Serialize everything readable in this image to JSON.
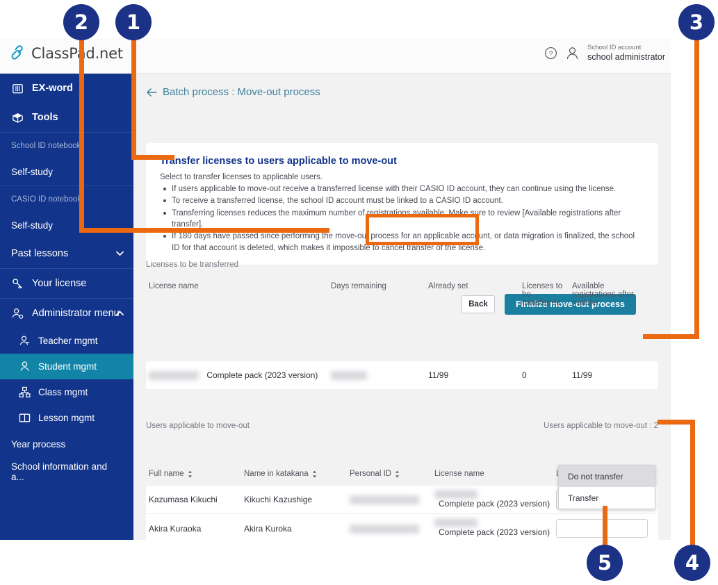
{
  "app": {
    "logo_text": "ClassPad.net",
    "logo_icon": "chain-link-icon"
  },
  "topbar": {
    "help_icon": "question-mark-circle-icon",
    "user_icon": "person-icon",
    "account_kind": "School ID account",
    "account_name": "school administrator"
  },
  "sidebar": {
    "items": [
      {
        "label": "EX-word",
        "icon": "book-icon",
        "type": "main"
      },
      {
        "label": "Tools",
        "icon": "box-icon",
        "type": "main"
      },
      {
        "label": "School ID notebook",
        "type": "caption"
      },
      {
        "label": "Self-study",
        "type": "plain"
      },
      {
        "label": "CASIO ID notebook",
        "type": "caption"
      },
      {
        "label": "Self-study",
        "type": "plain"
      },
      {
        "label": "Past lessons",
        "type": "plain",
        "chevron": "chevron-down-icon"
      },
      {
        "label": "Your license",
        "icon": "key-icon",
        "type": "main"
      },
      {
        "label": "Administrator menu",
        "icon": "person-gear-icon",
        "type": "main",
        "chevron": "chevron-up-icon"
      },
      {
        "label": "Teacher mgmt",
        "icon": "person-icon",
        "type": "sub"
      },
      {
        "label": "Student mgmt",
        "icon": "person-icon",
        "type": "sub",
        "active": true
      },
      {
        "label": "Class mgmt",
        "icon": "org-chart-icon",
        "type": "sub"
      },
      {
        "label": "Lesson mgmt",
        "icon": "open-book-icon",
        "type": "sub"
      },
      {
        "label": "Year process",
        "type": "plain"
      },
      {
        "label": "School information and a...",
        "type": "plain"
      }
    ]
  },
  "breadcrumb": {
    "back_icon": "left-arrow-icon",
    "label": "Batch process : Move-out process"
  },
  "info_card": {
    "title": "Transfer licenses to users applicable to move-out",
    "lead": "Select to transfer licenses to applicable users.",
    "bullets": [
      "If users applicable to move-out receive a transferred license with their CASIO ID account, they can continue using the license.",
      "To receive a transferred license, the school ID account must be linked to a CASIO ID account.",
      "Transferring licenses reduces the maximum number of registrations available. Make sure to review [Available registrations after transfer].",
      "If 180 days have passed since performing the move-out process for an applicable account, or data migration is finalized, the school ID for that account is deleted, which makes it impossible to cancel transfer of the license."
    ]
  },
  "buttons": {
    "back": "Back",
    "finalize": "Finalize move-out process"
  },
  "licenses_section": {
    "caption": "Licenses to be transferred",
    "columns": [
      "License name",
      "Days remaining",
      "Already set",
      "Licenses to be transferred",
      "Available registrations after transfer"
    ],
    "rows": [
      {
        "license_name": "Complete pack (2023 version)",
        "days_remaining": "",
        "already_set": "11/99",
        "to_be_transferred": "0",
        "available_after": "11/99"
      }
    ]
  },
  "users_section": {
    "caption": "Users applicable to move-out",
    "count_label": "Users applicable to move-out : 2",
    "columns": [
      "Full name",
      "Name in katakana",
      "Personal ID",
      "License name",
      "License transfer"
    ],
    "rows": [
      {
        "full_name": "Kazumasa Kikuchi",
        "katakana": "Kikuchi Kazushige",
        "personal_id": "",
        "license_name": "Complete pack (2023 version)",
        "license_transfer": ""
      },
      {
        "full_name": "Akira Kuraoka",
        "katakana": "Akira Kuroka",
        "personal_id": "",
        "license_name": "Complete pack (2023 version)",
        "license_transfer": ""
      }
    ]
  },
  "dropdown": {
    "options": [
      "Do not transfer",
      "Transfer"
    ],
    "highlighted": "Do not transfer"
  },
  "annotations": {
    "badges": [
      "1",
      "2",
      "3",
      "4",
      "5"
    ],
    "accent_color": "#ea6911",
    "badge_color": "#1b3287"
  }
}
